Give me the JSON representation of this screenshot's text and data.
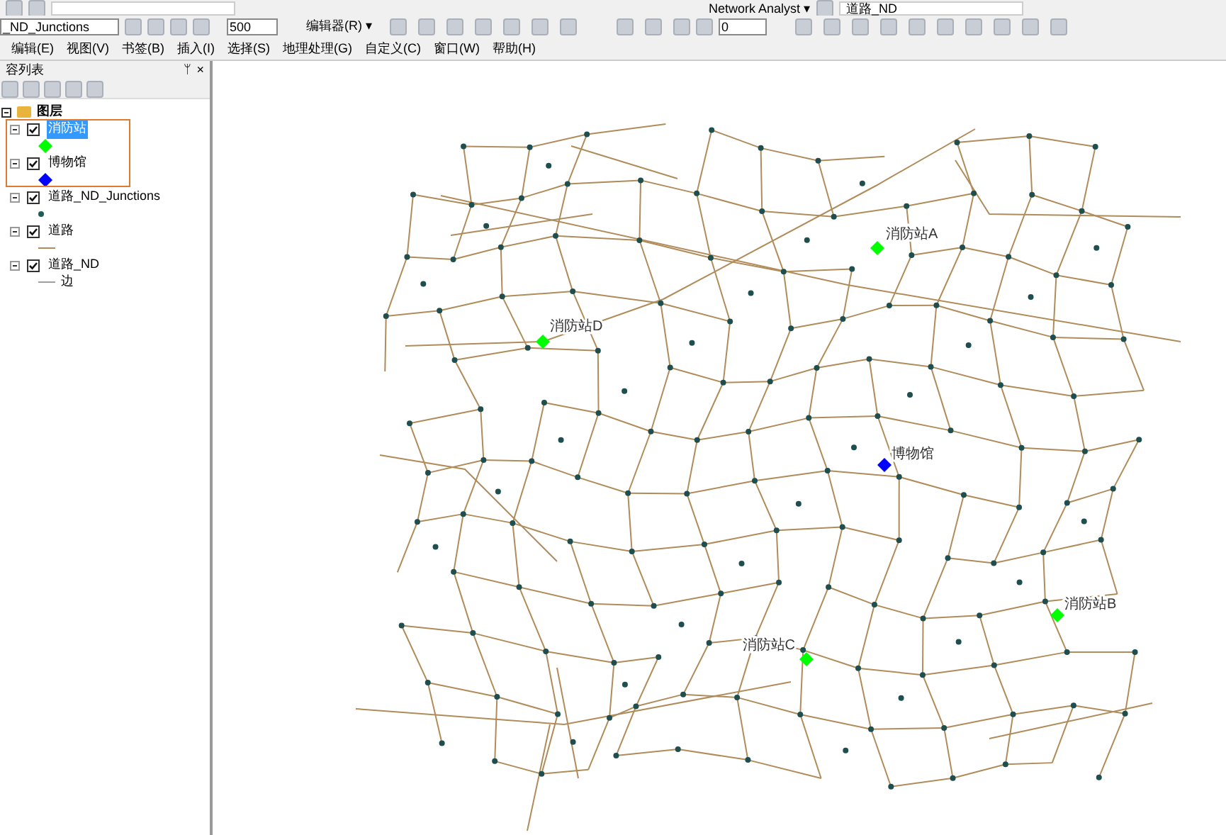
{
  "toolbar_top": {
    "network_analyst": "Network Analyst ▾",
    "network_dataset": "道路_ND"
  },
  "toolbar": {
    "target_layer": "_ND_Junctions",
    "scale": "500",
    "editor": "编辑器(R) ▾",
    "count": "0"
  },
  "menu": [
    "编辑(E)",
    "视图(V)",
    "书签(B)",
    "插入(I)",
    "选择(S)",
    "地理处理(G)",
    "自定义(C)",
    "窗口(W)",
    "帮助(H)"
  ],
  "toc": {
    "title": "容列表",
    "pin": "ᛘ",
    "close": "×",
    "root": {
      "name": "图层",
      "expanded": true,
      "children": [
        {
          "name": "消防站",
          "checked": true,
          "expanded": true,
          "selected": true,
          "kind": "diamond",
          "color": "#00ff00"
        },
        {
          "name": "博物馆",
          "checked": true,
          "expanded": true,
          "selected": false,
          "kind": "diamond",
          "color": "#0000ff"
        },
        {
          "name": "道路_ND_Junctions",
          "checked": true,
          "expanded": true,
          "selected": false,
          "kind": "dot",
          "color": "#1f5c5c"
        },
        {
          "name": "道路",
          "checked": true,
          "expanded": true,
          "selected": false,
          "kind": "line",
          "color": "#b08c5a"
        },
        {
          "name": "道路_ND",
          "checked": true,
          "expanded": true,
          "selected": false,
          "kind": "line",
          "color": "#a0a0a0",
          "legend_label": "边"
        }
      ]
    }
  },
  "map": {
    "markers": [
      {
        "kind": "fire_station",
        "label": "消防站A"
      },
      {
        "kind": "fire_station",
        "label": "消防站D"
      },
      {
        "kind": "museum",
        "label": "博物馆"
      },
      {
        "kind": "fire_station",
        "label": "消防站B"
      },
      {
        "kind": "fire_station",
        "label": "消防站C"
      }
    ]
  }
}
